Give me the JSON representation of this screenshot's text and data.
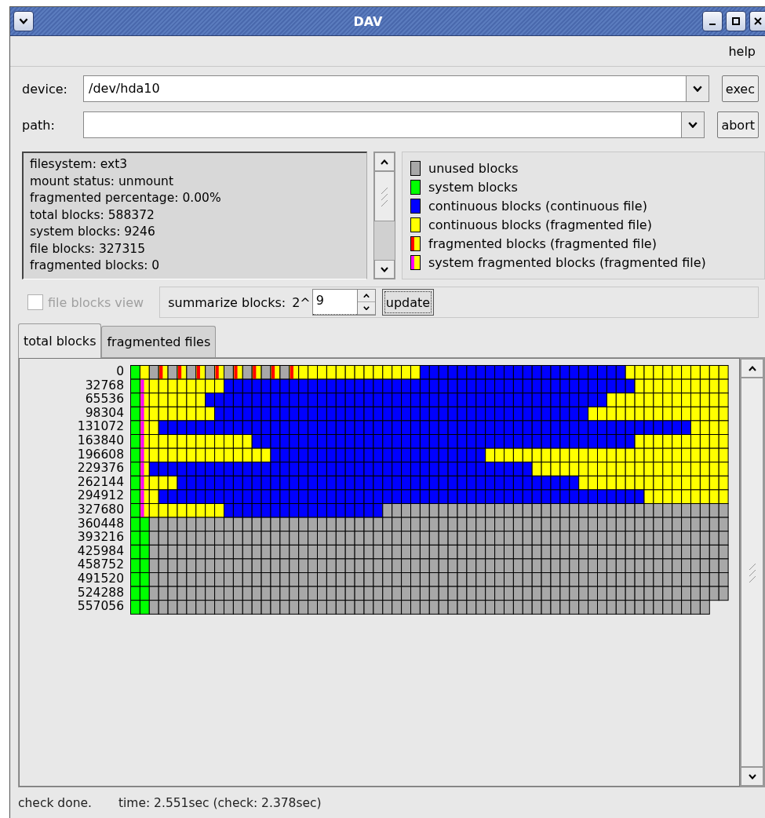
{
  "window": {
    "title": "DAV"
  },
  "menu": [
    {
      "label": "help"
    }
  ],
  "device": {
    "label": "device:",
    "value": "/dev/hda10",
    "button": "exec"
  },
  "path": {
    "label": "path:",
    "button": "abort"
  },
  "info": {
    "lines": [
      "filesystem: ext3",
      "mount status: unmount",
      "fragmented percentage: 0.00%",
      "total blocks: 588372",
      "system blocks: 9246",
      "file blocks: 327315",
      "fragmented blocks: 0"
    ]
  },
  "legend": [
    {
      "label": "unused blocks",
      "kind": "solid",
      "color": "#a8a8a8"
    },
    {
      "label": "system blocks",
      "kind": "solid",
      "color": "#00ff00"
    },
    {
      "label": "continuous blocks (continuous file)",
      "kind": "solid",
      "color": "#0000ff"
    },
    {
      "label": "continuous blocks (fragmented file)",
      "kind": "solid",
      "color": "#ffff00"
    },
    {
      "label": "fragmented blocks (fragmented file)",
      "kind": "split",
      "color": "#ff0000"
    },
    {
      "label": "system fragmented blocks (fragmented file)",
      "kind": "split",
      "color": "#ff00ff"
    }
  ],
  "file_blocks_view": {
    "label": "file blocks view",
    "checked": false,
    "disabled": true
  },
  "summarize": {
    "label": "summarize blocks:",
    "prefix": "2^",
    "value": "9",
    "button": "update"
  },
  "tabs": [
    {
      "label": "total blocks",
      "selected": true
    },
    {
      "label": "fragmented files",
      "selected": false
    }
  ],
  "map": {
    "rows": [
      {
        "label": "0"
      },
      {
        "label": "32768"
      },
      {
        "label": "65536"
      },
      {
        "label": "98304"
      },
      {
        "label": "131072"
      },
      {
        "label": "163840"
      },
      {
        "label": "196608"
      },
      {
        "label": "229376"
      },
      {
        "label": "262144"
      },
      {
        "label": "294912"
      },
      {
        "label": "327680"
      },
      {
        "label": "360448"
      },
      {
        "label": "393216"
      },
      {
        "label": "425984"
      },
      {
        "label": "458752"
      },
      {
        "label": "491520"
      },
      {
        "label": "524288"
      },
      {
        "label": "557056"
      }
    ]
  },
  "status_bar": {
    "message": "check done.",
    "time": "time: 2.551sec (check: 2.378sec)"
  }
}
